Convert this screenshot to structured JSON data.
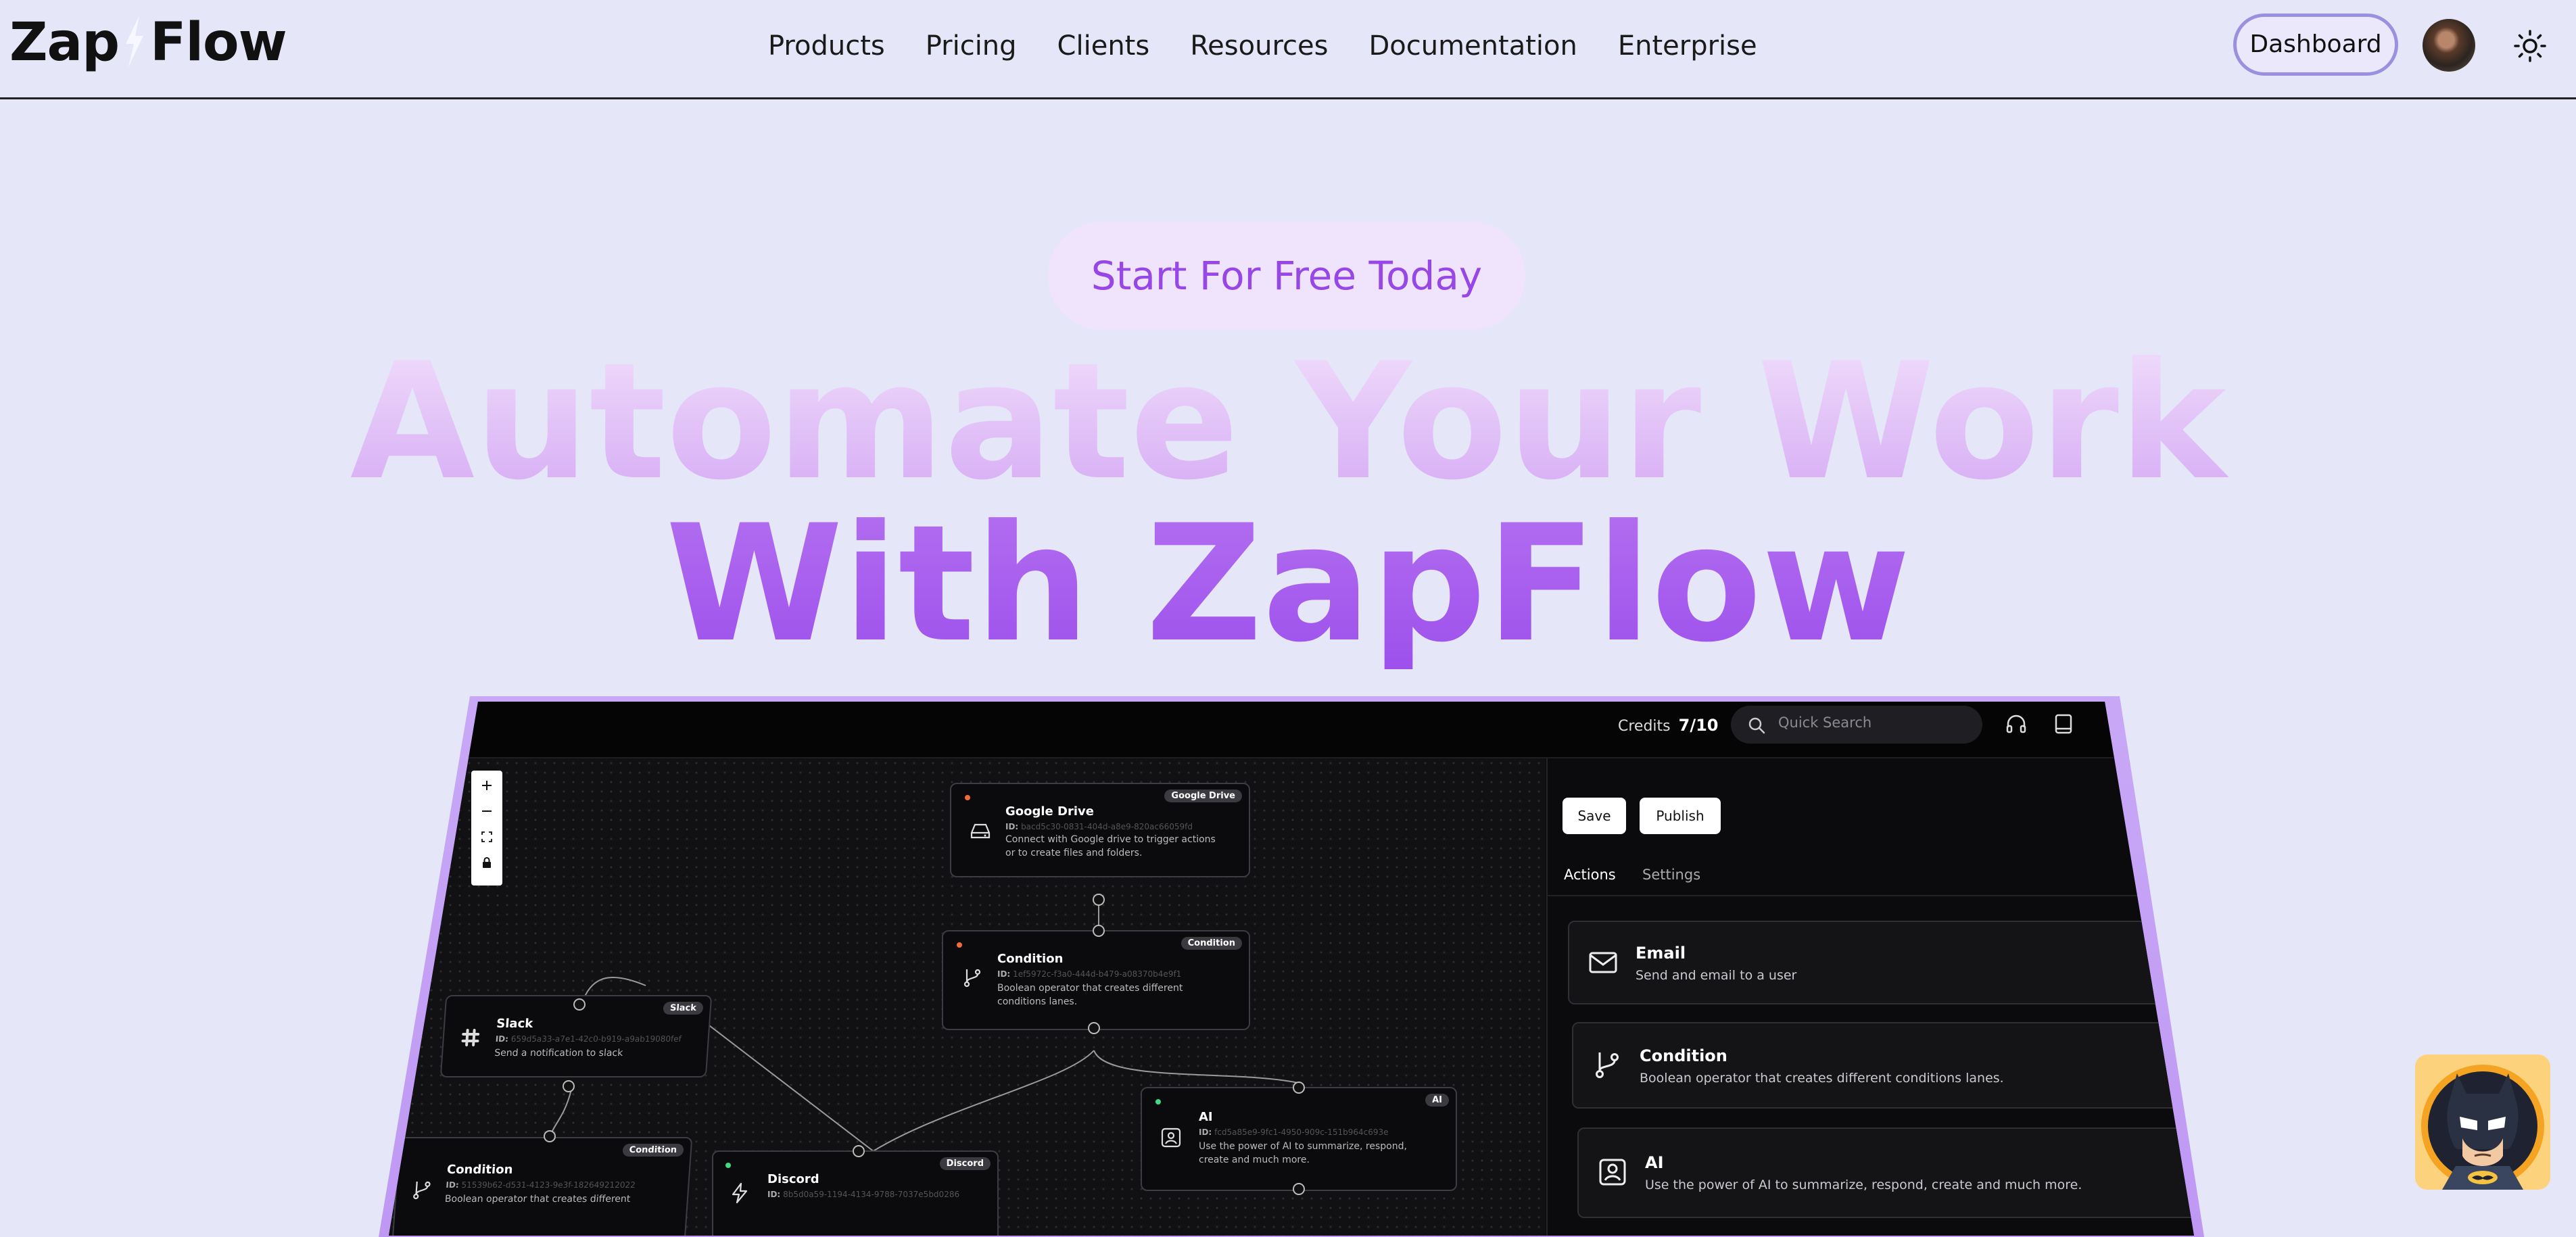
{
  "nav": {
    "logo_left": "Zap",
    "logo_right": "Flow",
    "items": [
      "Products",
      "Pricing",
      "Clients",
      "Resources",
      "Documentation",
      "Enterprise"
    ],
    "dashboard_label": "Dashboard",
    "avatar_icon": "user-avatar",
    "theme_icon": "sun-icon"
  },
  "hero": {
    "cta_label": "Start For Free Today",
    "headline_line1": "Automate Your Work",
    "headline_line2": "With ZapFlow",
    "colors": {
      "cta_text": "#9747e6",
      "headline_top": "#e2c3f7",
      "headline_bottom": "#9d50ec"
    }
  },
  "preview": {
    "credits_label": "Credits",
    "credits_value": "7/10",
    "search_placeholder": "Quick Search",
    "headset_icon": "headset-icon",
    "book_icon": "book-icon",
    "toolbar_icons": [
      "plus-icon",
      "minus-icon",
      "fit-view-icon",
      "lock-icon"
    ],
    "nodes": {
      "google_drive": {
        "title": "Google Drive",
        "badge": "Google Drive",
        "id_label": "ID:",
        "id": "bacd5c30-0831-404d-a8e9-820ac66059fd",
        "desc_line1": "Connect with Google drive to trigger actions",
        "desc_line2": "or to create files and folders."
      },
      "condition_top": {
        "title": "Condition",
        "badge": "Condition",
        "id_label": "ID:",
        "id": "1ef5972c-f3a0-444d-b479-a08370b4e9f1",
        "desc_line1": "Boolean operator that creates different",
        "desc_line2": "conditions lanes."
      },
      "slack": {
        "title": "Slack",
        "badge": "Slack",
        "id_label": "ID:",
        "id": "659d5a33-a7e1-42c0-b919-a9ab19080fef",
        "desc_line1": "Send a notification to slack"
      },
      "ai": {
        "title": "AI",
        "badge": "AI",
        "id_label": "ID:",
        "id": "fcd5a85e9-9fc1-4950-909c-151b964c693e",
        "desc_line1": "Use the power of AI to summarize, respond,",
        "desc_line2": "create and much more."
      },
      "condition_bottom": {
        "title": "Condition",
        "badge": "Condition",
        "id_label": "ID:",
        "id": "51539b62-d531-4123-9e3f-182649212022",
        "desc_line1": "Boolean operator that creates different"
      },
      "discord": {
        "title": "Discord",
        "badge": "Discord",
        "id_label": "ID:",
        "id": "8b5d0a59-1194-4134-9788-7037e5bd0286"
      }
    },
    "panel": {
      "save_label": "Save",
      "publish_label": "Publish",
      "tabs": [
        "Actions",
        "Settings"
      ],
      "actions": [
        {
          "title": "Email",
          "desc": "Send and email to a user",
          "icon": "mail-icon"
        },
        {
          "title": "Condition",
          "desc": "Boolean operator that creates different conditions lanes.",
          "icon": "branch-icon"
        },
        {
          "title": "AI",
          "desc": "Use the power of AI to summarize, respond, create and much more.",
          "icon": "ai-icon"
        }
      ]
    }
  },
  "widget": {
    "icon": "batman-avatar-icon"
  }
}
